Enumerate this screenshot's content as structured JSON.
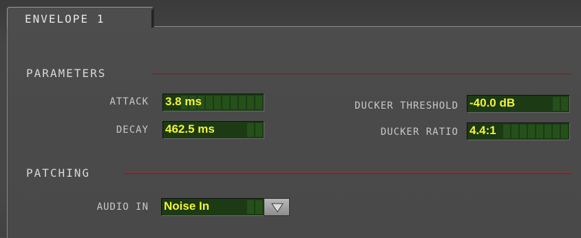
{
  "tab": {
    "label": "ENVELOPE 1"
  },
  "parameters": {
    "title": "PARAMETERS",
    "attack": {
      "label": "ATTACK",
      "value": "3.8 ms"
    },
    "decay": {
      "label": "DECAY",
      "value": "462.5 ms"
    },
    "ducker_threshold": {
      "label": "DUCKER THRESHOLD",
      "value": "-40.0 dB"
    },
    "ducker_ratio": {
      "label": "DUCKER RATIO",
      "value": "4.4:1"
    }
  },
  "patching": {
    "title": "PATCHING",
    "audio_in": {
      "label": "AUDIO IN",
      "value": "Noise In",
      "dropdown_icon": "triangle-down-icon"
    }
  },
  "colors": {
    "accent_line": "#b0202a",
    "lcd_text": "#f4f43a",
    "lcd_background": "#1c3a14"
  }
}
